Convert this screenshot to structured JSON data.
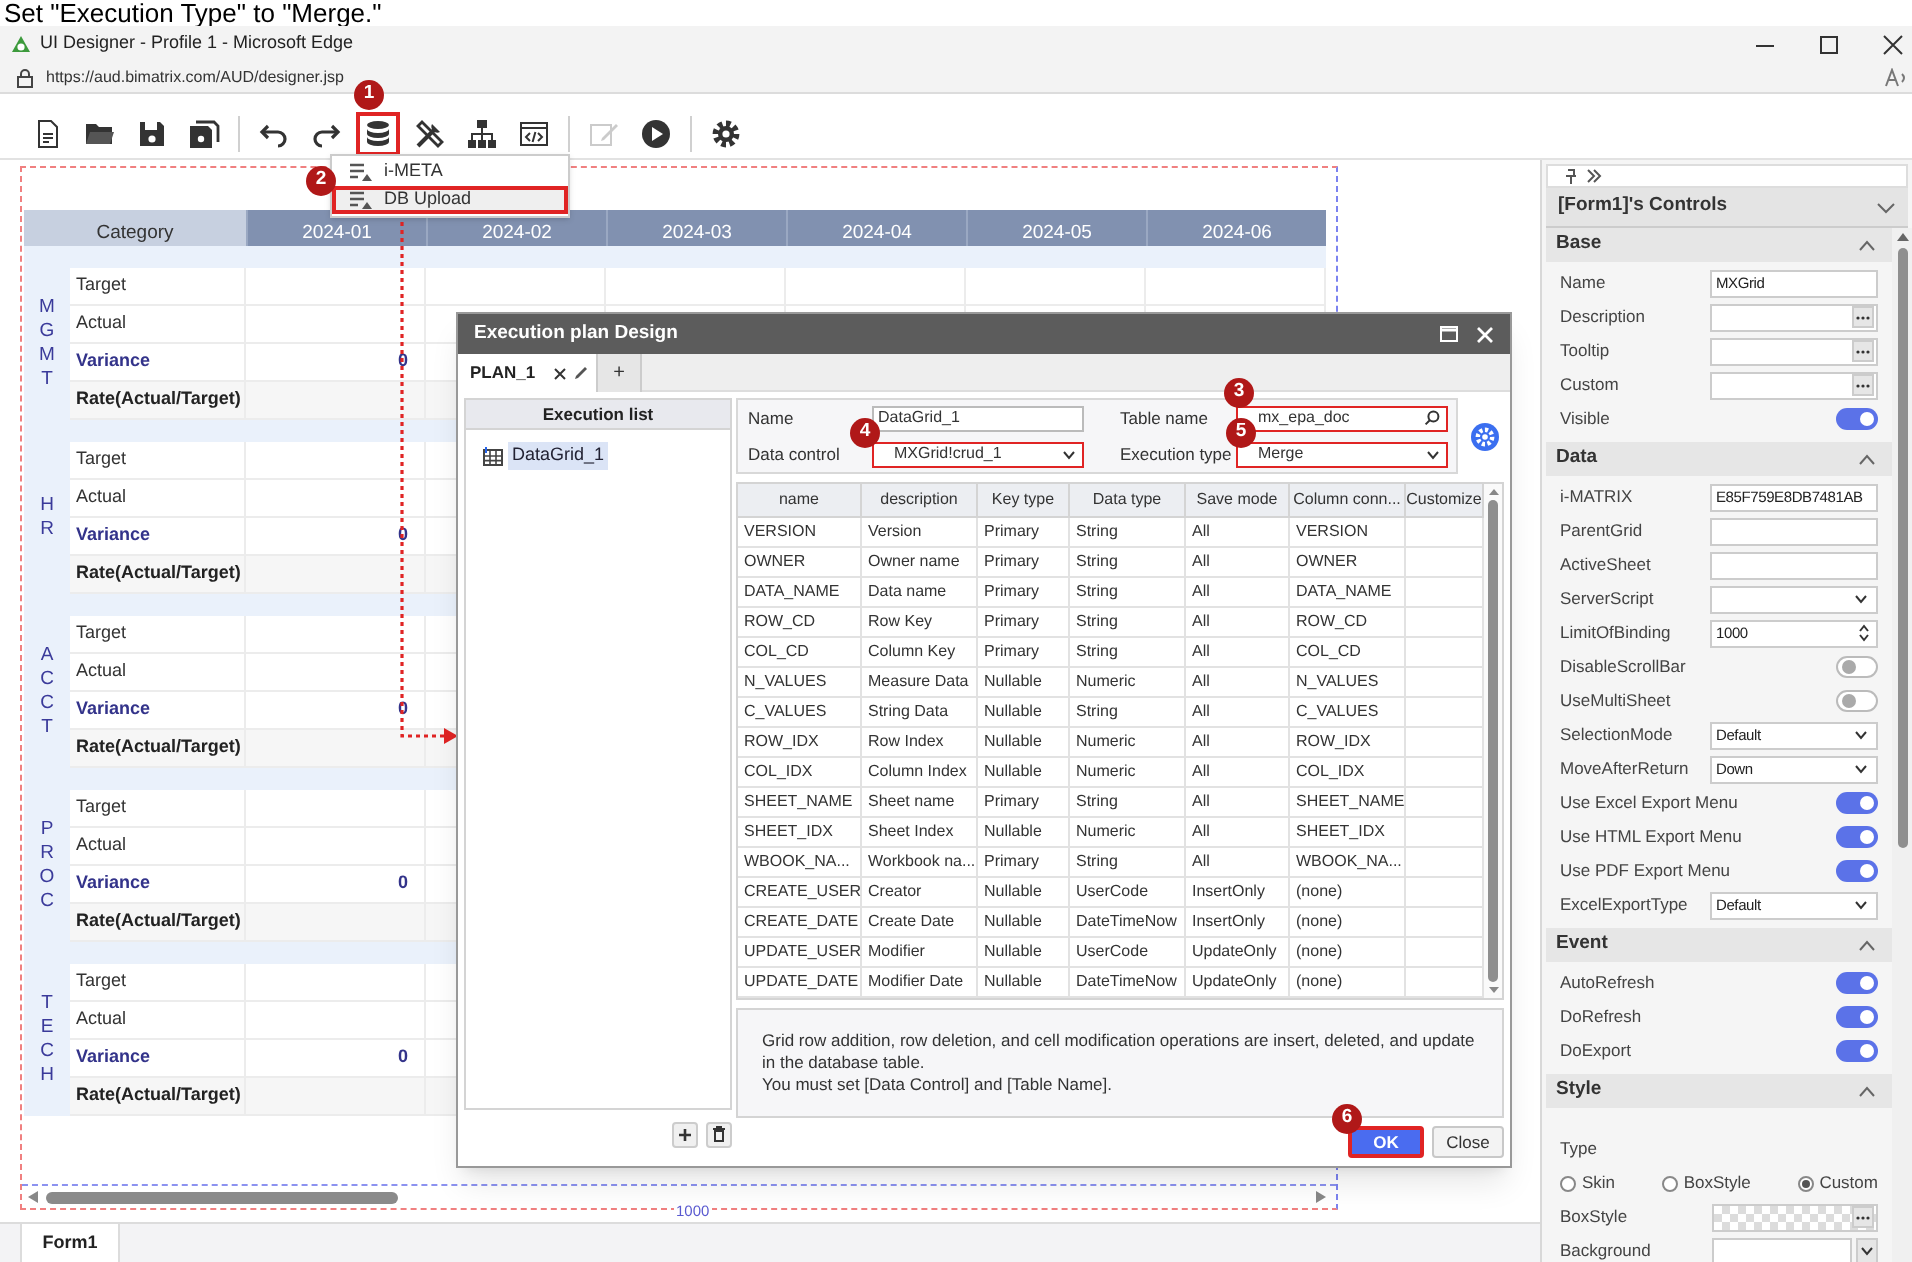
{
  "caption": "Set \"Execution Type\" to \"Merge.\"",
  "browser": {
    "title": "UI Designer - Profile 1 - Microsoft Edge",
    "url": "https://aud.bimatrix.com/AUD/designer.jsp"
  },
  "toolbar": [
    {
      "kind": "document",
      "highlighted": false,
      "disabled": false
    },
    {
      "kind": "folder",
      "highlighted": false,
      "disabled": false
    },
    {
      "kind": "save",
      "highlighted": false,
      "disabled": false
    },
    {
      "kind": "save-all",
      "highlighted": false,
      "disabled": false
    },
    {
      "kind": "separator"
    },
    {
      "kind": "undo",
      "highlighted": false,
      "disabled": false
    },
    {
      "kind": "redo",
      "highlighted": false,
      "disabled": false
    },
    {
      "kind": "database",
      "highlighted": true,
      "disabled": false
    },
    {
      "kind": "tools",
      "highlighted": false,
      "disabled": false
    },
    {
      "kind": "hierarchy",
      "highlighted": false,
      "disabled": false
    },
    {
      "kind": "code",
      "highlighted": false,
      "disabled": false
    },
    {
      "kind": "separator"
    },
    {
      "kind": "edit",
      "highlighted": false,
      "disabled": true
    },
    {
      "kind": "play",
      "highlighted": false,
      "disabled": false
    },
    {
      "kind": "separator"
    },
    {
      "kind": "settings",
      "highlighted": false,
      "disabled": false
    }
  ],
  "menu": [
    {
      "label": "i-META",
      "highlighted": false
    },
    {
      "label": "DB Upload",
      "highlighted": true
    }
  ],
  "steps": [
    "1",
    "2",
    "3",
    "4",
    "5",
    "6"
  ],
  "grid": {
    "columns": [
      "Category",
      "2024-01",
      "2024-02",
      "2024-03",
      "2024-04",
      "2024-05",
      "2024-06"
    ],
    "groups": [
      {
        "name": "MGMT",
        "rows": [
          {
            "kind": "plain",
            "label": "Target"
          },
          {
            "kind": "plain",
            "label": "Actual"
          },
          {
            "kind": "variance",
            "label": "Variance",
            "value": "0"
          },
          {
            "kind": "rate",
            "label": "Rate(Actual/Target)"
          }
        ]
      },
      {
        "name": "HR",
        "rows": [
          {
            "kind": "plain",
            "label": "Target"
          },
          {
            "kind": "plain",
            "label": "Actual"
          },
          {
            "kind": "variance",
            "label": "Variance",
            "value": "0"
          },
          {
            "kind": "rate",
            "label": "Rate(Actual/Target)"
          }
        ]
      },
      {
        "name": "ACCT",
        "rows": [
          {
            "kind": "plain",
            "label": "Target"
          },
          {
            "kind": "plain",
            "label": "Actual"
          },
          {
            "kind": "variance",
            "label": "Variance",
            "value": "0"
          },
          {
            "kind": "rate",
            "label": "Rate(Actual/Target)"
          }
        ]
      },
      {
        "name": "PROC",
        "rows": [
          {
            "kind": "plain",
            "label": "Target"
          },
          {
            "kind": "plain",
            "label": "Actual"
          },
          {
            "kind": "variance",
            "label": "Variance",
            "value": "0"
          },
          {
            "kind": "rate",
            "label": "Rate(Actual/Target)"
          }
        ]
      },
      {
        "name": "TECH",
        "rows": [
          {
            "kind": "plain",
            "label": "Target"
          },
          {
            "kind": "plain",
            "label": "Actual"
          },
          {
            "kind": "variance",
            "label": "Variance",
            "value": "0"
          },
          {
            "kind": "rate",
            "label": "Rate(Actual/Target)"
          }
        ]
      }
    ],
    "ruler": "1000"
  },
  "bottom_tabs": [
    {
      "label": "Form1",
      "selected": true
    }
  ],
  "dialog": {
    "title": "Execution plan Design",
    "tabs": [
      {
        "label": "PLAN_1",
        "selected": true
      }
    ],
    "add_tab": "+",
    "execution_list": {
      "title": "Execution list",
      "items": [
        {
          "label": "DataGrid_1",
          "selected": true
        }
      ]
    },
    "fields": [
      {
        "label": "Name",
        "kind": "text",
        "value": "DataGrid_1",
        "highlighted": false
      },
      {
        "label": "Table name",
        "kind": "search",
        "value": "mx_epa_doc",
        "highlighted": true
      },
      {
        "label": "Data control",
        "kind": "select",
        "value": "MXGrid!crud_1",
        "highlighted": true
      },
      {
        "label": "Execution type",
        "kind": "select",
        "value": "Merge",
        "highlighted": true
      }
    ],
    "table": {
      "columns": [
        "name",
        "description",
        "Key type",
        "Data type",
        "Save mode",
        "Column conn...",
        "Customize"
      ],
      "rows": [
        [
          "VERSION",
          "Version",
          "Primary",
          "String",
          "All",
          "VERSION"
        ],
        [
          "OWNER",
          "Owner name",
          "Primary",
          "String",
          "All",
          "OWNER"
        ],
        [
          "DATA_NAME",
          "Data name",
          "Primary",
          "String",
          "All",
          "DATA_NAME"
        ],
        [
          "ROW_CD",
          "Row Key",
          "Primary",
          "String",
          "All",
          "ROW_CD"
        ],
        [
          "COL_CD",
          "Column Key",
          "Primary",
          "String",
          "All",
          "COL_CD"
        ],
        [
          "N_VALUES",
          "Measure Data",
          "Nullable",
          "Numeric",
          "All",
          "N_VALUES"
        ],
        [
          "C_VALUES",
          "String Data",
          "Nullable",
          "String",
          "All",
          "C_VALUES"
        ],
        [
          "ROW_IDX",
          "Row Index",
          "Nullable",
          "Numeric",
          "All",
          "ROW_IDX"
        ],
        [
          "COL_IDX",
          "Column Index",
          "Nullable",
          "Numeric",
          "All",
          "COL_IDX"
        ],
        [
          "SHEET_NAME",
          "Sheet name",
          "Primary",
          "String",
          "All",
          "SHEET_NAME"
        ],
        [
          "SHEET_IDX",
          "Sheet Index",
          "Nullable",
          "Numeric",
          "All",
          "SHEET_IDX"
        ],
        [
          "WBOOK_NA...",
          "Workbook na...",
          "Primary",
          "String",
          "All",
          "WBOOK_NA..."
        ],
        [
          "CREATE_USER",
          "Creator",
          "Nullable",
          "UserCode",
          "InsertOnly",
          "(none)"
        ],
        [
          "CREATE_DATE",
          "Create Date",
          "Nullable",
          "DateTimeNow",
          "InsertOnly",
          "(none)"
        ],
        [
          "UPDATE_USER",
          "Modifier",
          "Nullable",
          "UserCode",
          "UpdateOnly",
          "(none)"
        ],
        [
          "UPDATE_DATE",
          "Modifier Date",
          "Nullable",
          "DateTimeNow",
          "UpdateOnly",
          "(none)"
        ]
      ]
    },
    "note": [
      "Grid row addition, row deletion, and cell modification operations are insert, deleted, and update in the database table.",
      "You must set [Data Control] and [Table Name]."
    ],
    "buttons": [
      {
        "label": "OK",
        "kind": "primary",
        "highlighted": true
      },
      {
        "label": "Close",
        "kind": "secondary",
        "highlighted": false
      }
    ]
  },
  "properties": {
    "title": "[Form1]'s Controls",
    "sections": [
      {
        "title": "Base",
        "expanded": true,
        "rows": [
          {
            "label": "Name",
            "kind": "text",
            "value": "MXGrid"
          },
          {
            "label": "Description",
            "kind": "ellipsis"
          },
          {
            "label": "Tooltip",
            "kind": "ellipsis"
          },
          {
            "label": "Custom",
            "kind": "ellipsis"
          },
          {
            "label": "Visible",
            "kind": "toggle",
            "on": true
          }
        ]
      },
      {
        "title": "Data",
        "expanded": true,
        "rows": [
          {
            "label": "i-MATRIX",
            "kind": "text",
            "value": "E85F759E8DB7481AB"
          },
          {
            "label": "ParentGrid",
            "kind": "text"
          },
          {
            "label": "ActiveSheet",
            "kind": "text"
          },
          {
            "label": "ServerScript",
            "kind": "select"
          },
          {
            "label": "LimitOfBinding",
            "kind": "spin",
            "value": "1000"
          },
          {
            "label": "DisableScrollBar",
            "kind": "toggle",
            "on": false
          },
          {
            "label": "UseMultiSheet",
            "kind": "toggle",
            "on": false
          },
          {
            "label": "SelectionMode",
            "kind": "select",
            "value": "Default"
          },
          {
            "label": "MoveAfterReturn",
            "kind": "select",
            "value": "Down"
          },
          {
            "label": "Use Excel Export Menu",
            "kind": "toggle",
            "on": true
          },
          {
            "label": "Use HTML Export Menu",
            "kind": "toggle",
            "on": true
          },
          {
            "label": "Use PDF Export Menu",
            "kind": "toggle",
            "on": true
          },
          {
            "label": "ExcelExportType",
            "kind": "select",
            "value": "Default"
          }
        ]
      },
      {
        "title": "Event",
        "expanded": true,
        "rows": [
          {
            "label": "AutoRefresh",
            "kind": "toggle",
            "on": true
          },
          {
            "label": "DoRefresh",
            "kind": "toggle",
            "on": true
          },
          {
            "label": "DoExport",
            "kind": "toggle",
            "on": true
          }
        ]
      },
      {
        "title": "Style",
        "expanded": true,
        "rows": [
          {
            "label": "Type",
            "kind": "heading"
          },
          {
            "kind": "radios",
            "options": [
              {
                "label": "Skin",
                "selected": false
              },
              {
                "label": "BoxStyle",
                "selected": false
              },
              {
                "label": "Custom",
                "selected": true
              }
            ]
          },
          {
            "label": "BoxStyle",
            "kind": "pattern"
          },
          {
            "label": "Background",
            "kind": "color"
          }
        ]
      }
    ]
  }
}
